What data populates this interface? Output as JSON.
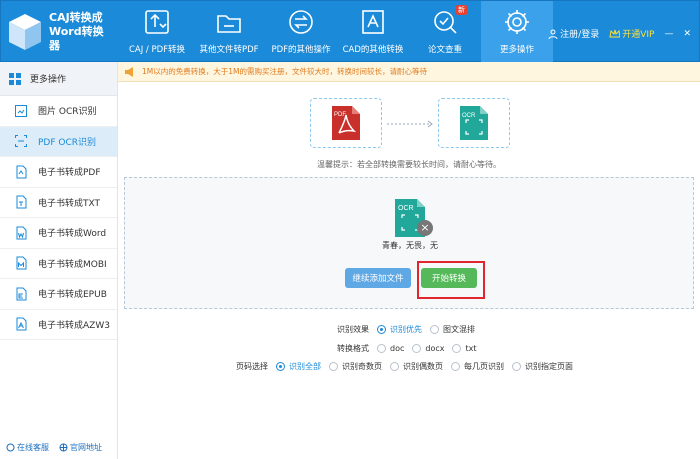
{
  "app": {
    "name_line1": "CAJ转换成",
    "name_line2": "Word转换",
    "name_line3": "器"
  },
  "nav": [
    {
      "label": "CAJ / PDF转换",
      "icon": "convert-icon"
    },
    {
      "label": "其他文件转PDF",
      "icon": "folder-icon"
    },
    {
      "label": "PDF的其他操作",
      "icon": "swap-icon"
    },
    {
      "label": "CAD的其他转换",
      "icon": "cad-icon"
    },
    {
      "label": "论文查重",
      "icon": "search-doc-icon",
      "badge": "新"
    },
    {
      "label": "更多操作",
      "icon": "gear-icon"
    }
  ],
  "user": {
    "login": "注册/登录",
    "vip": "开通VIP"
  },
  "sidebar": {
    "header": "更多操作",
    "items": [
      {
        "label": "图片 OCR识别"
      },
      {
        "label": "PDF OCR识别"
      },
      {
        "label": "电子书转成PDF"
      },
      {
        "label": "电子书转成TXT"
      },
      {
        "label": "电子书转成Word"
      },
      {
        "label": "电子书转成MOBI"
      },
      {
        "label": "电子书转成EPUB"
      },
      {
        "label": "电子书转成AZW3"
      }
    ],
    "footer_service": "在线客服",
    "footer_site": "官网地址"
  },
  "notice": "1M以内的免费转换，大于1M的需购买注册，文件较大时，转换时间较长，请耐心等待",
  "flow": {
    "from_label": "PDF",
    "to_label": "OCR"
  },
  "tip": "温馨提示：若全部转换需要较长时间，请耐心等待。",
  "file": {
    "tile_label": "OCR",
    "name": "青春，无畏，无"
  },
  "buttons": {
    "add": "继续添加文件",
    "start": "开始转换"
  },
  "options": {
    "effect": {
      "label": "识别效果",
      "choices": [
        "识别优先",
        "图文混排"
      ],
      "selected": "识别优先"
    },
    "format": {
      "label": "转换格式",
      "choices": [
        "doc",
        "docx",
        "txt"
      ]
    },
    "pages": {
      "label": "页码选择",
      "choices": [
        "识别全部",
        "识别奇数页",
        "识别偶数页",
        "每几页识别",
        "识别指定页面"
      ],
      "selected": "识别全部"
    }
  },
  "colors": {
    "header": "#1b8ad8",
    "accent": "#1b8ad8",
    "start_button": "#55b95a",
    "highlight_border": "#e1262d"
  }
}
